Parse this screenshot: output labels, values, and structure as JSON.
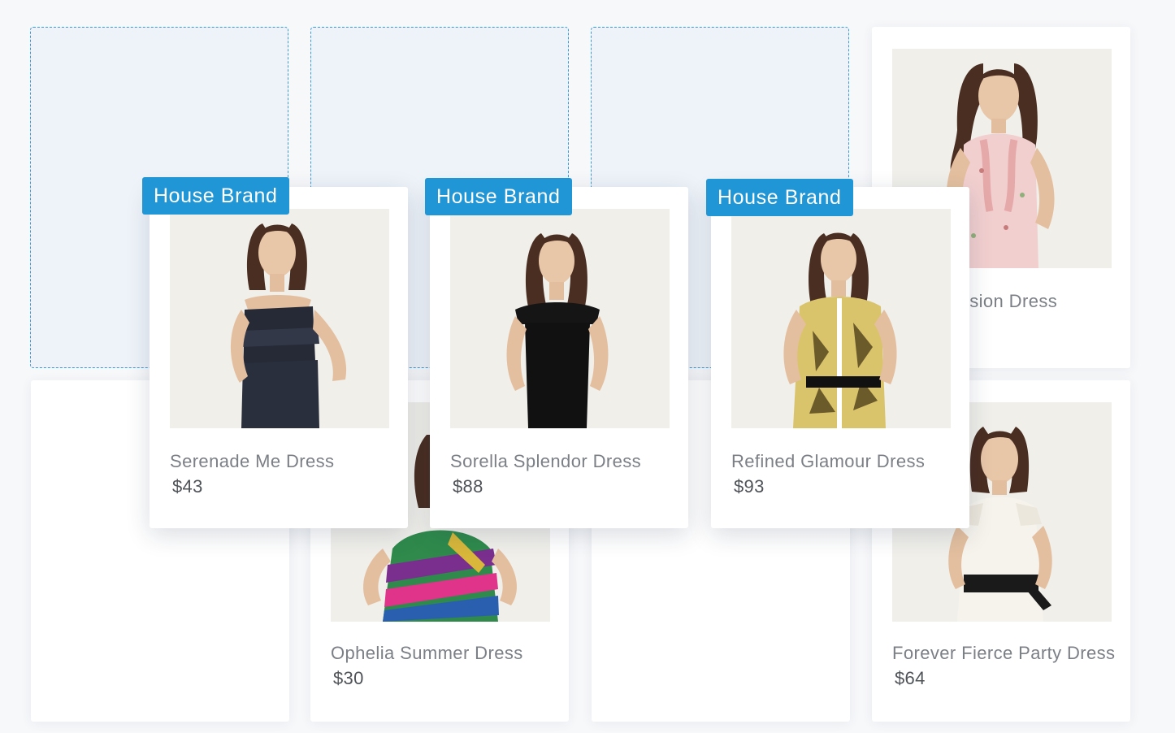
{
  "products": [
    {
      "name": "Serenade Me Dress",
      "price": "$43",
      "badge": "House Brand",
      "dress_icon": "strapless-ruffle-dress-photo",
      "dress_color": "#262a36",
      "state": "dragging"
    },
    {
      "name": "Sorella Splendor Dress",
      "price": "$88",
      "badge": "House Brand",
      "dress_icon": "off-shoulder-black-dress-photo",
      "dress_color": "#111111",
      "state": "dragging"
    },
    {
      "name": "Refined Glamour Dress",
      "price": "$93",
      "badge": "House Brand",
      "dress_icon": "yellow-print-dress-photo",
      "dress_color": "#d8c26a",
      "state": "dragging"
    },
    {
      "name": "Illusion Dress",
      "name_visible": "llusion Dress",
      "price": "",
      "dress_icon": "pink-ruffle-blouse-photo",
      "dress_color": "#f2cfcf",
      "state": "idle"
    },
    {
      "name": "Ophelia Summer Dress",
      "price": "$30",
      "dress_icon": "striped-summer-dress-photo",
      "dress_color": "#3d8a4a",
      "state": "idle"
    },
    {
      "name": "Forever Fierce Party Dress",
      "price": "$64",
      "dress_icon": "white-lace-dress-photo",
      "dress_color": "#f4f1ea",
      "state": "idle"
    }
  ],
  "colors": {
    "accent": "#2196d6",
    "placeholder_border": "#3a9ad9",
    "placeholder_fill": "#eef3f9",
    "card": "#ffffff",
    "background": "#f7f8fa"
  }
}
